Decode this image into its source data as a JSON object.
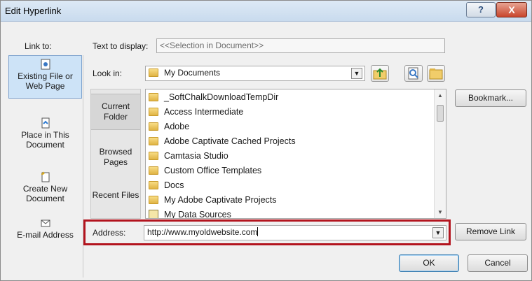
{
  "window": {
    "title": "Edit Hyperlink",
    "help_label": "?",
    "close_label": "X"
  },
  "link_to": {
    "label": "Link to:",
    "items": [
      {
        "label": "Existing File or Web Page",
        "icon": "web-page-icon",
        "selected": true
      },
      {
        "label": "Place in This Document",
        "icon": "document-place-icon",
        "selected": false
      },
      {
        "label": "Create New Document",
        "icon": "new-document-icon",
        "selected": false
      },
      {
        "label": "E-mail Address",
        "icon": "email-icon",
        "selected": false
      }
    ]
  },
  "text_to_display": {
    "label": "Text to display:",
    "value": "<<Selection in Document>>"
  },
  "look_in": {
    "label": "Look in:",
    "value": "My Documents",
    "icon": "my-documents-icon",
    "buttons": [
      "up-folder-icon",
      "browse-web-icon",
      "browse-file-icon"
    ]
  },
  "places": [
    {
      "label": "Current Folder",
      "selected": true
    },
    {
      "label": "Browsed Pages",
      "selected": false
    },
    {
      "label": "Recent Files",
      "selected": false
    }
  ],
  "files": [
    {
      "name": "_SoftChalkDownloadTempDir",
      "icon": "folder-icon"
    },
    {
      "name": "Access Intermediate",
      "icon": "folder-icon"
    },
    {
      "name": "Adobe",
      "icon": "folder-icon"
    },
    {
      "name": "Adobe Captivate Cached Projects",
      "icon": "folder-icon"
    },
    {
      "name": "Camtasia Studio",
      "icon": "folder-icon"
    },
    {
      "name": "Custom Office Templates",
      "icon": "folder-icon"
    },
    {
      "name": "Docs",
      "icon": "folder-icon"
    },
    {
      "name": "My Adobe Captivate Projects",
      "icon": "folder-icon"
    },
    {
      "name": "My Data Sources",
      "icon": "data-source-icon"
    }
  ],
  "address": {
    "label": "Address:",
    "value": "http://www.myoldwebsite.com"
  },
  "buttons": {
    "bookmark": "Bookmark...",
    "remove_link": "Remove Link",
    "ok": "OK",
    "cancel": "Cancel"
  }
}
